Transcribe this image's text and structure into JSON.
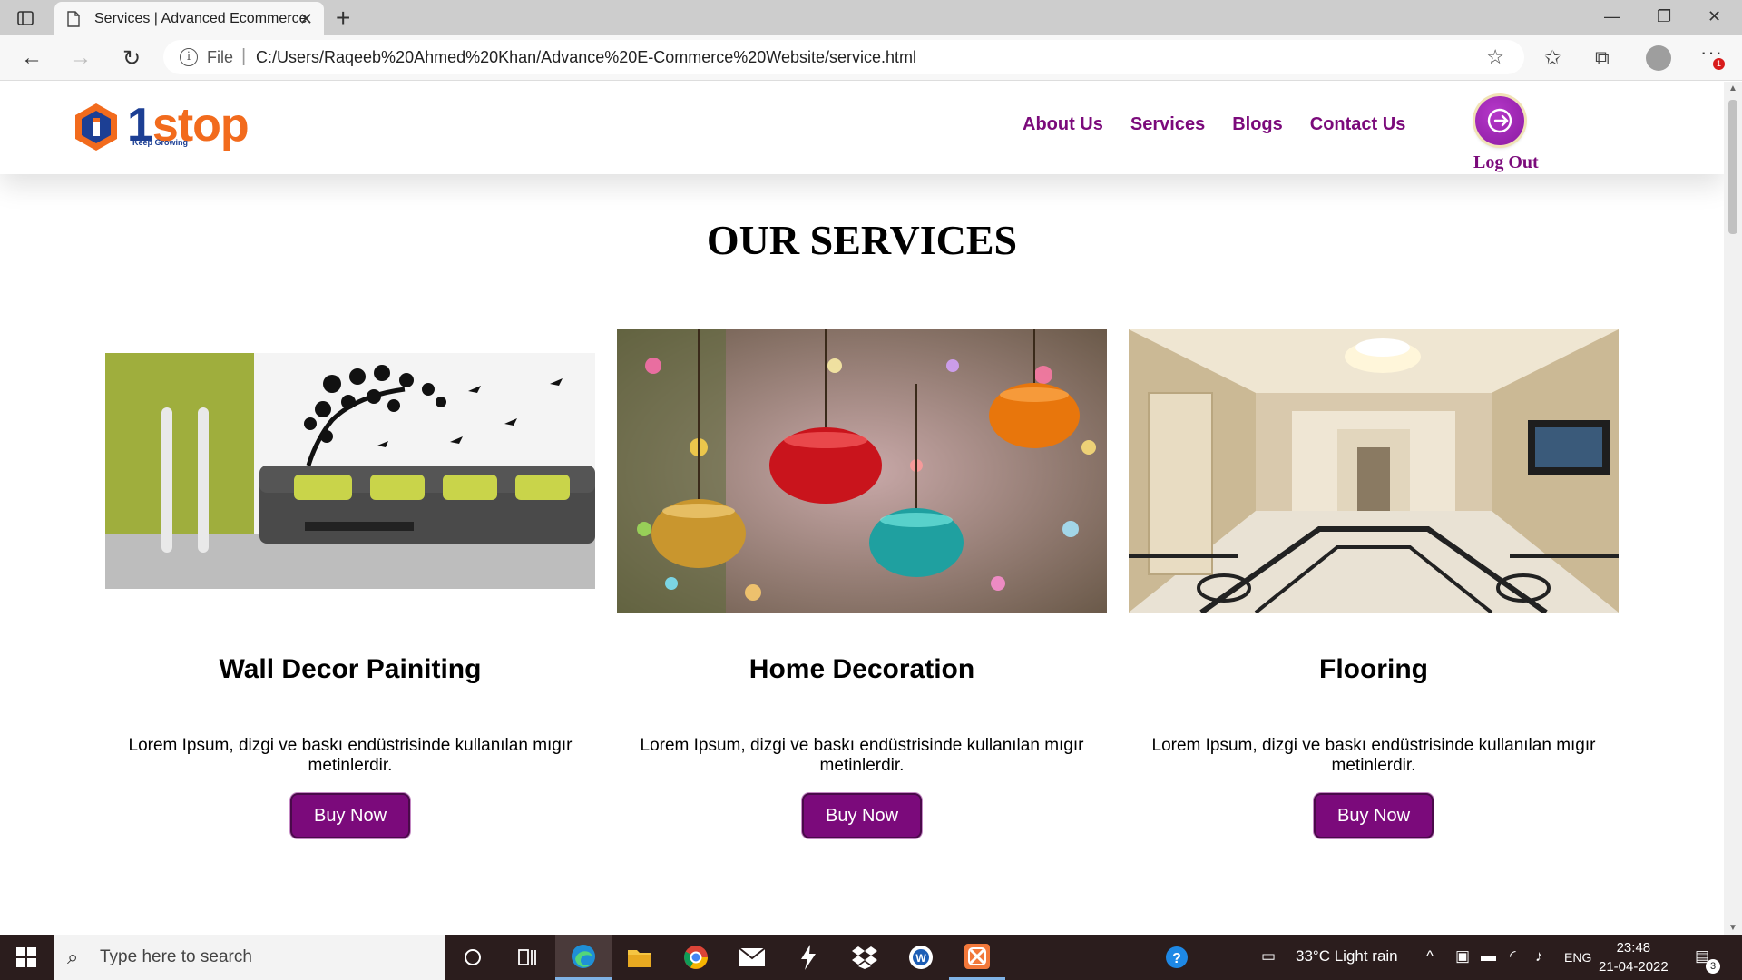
{
  "browser": {
    "tab_title": "Services | Advanced Ecommerce",
    "url_scheme_label": "File",
    "url": "C:/Users/Raqeeb%20Ahmed%20Khan/Advance%20E-Commerce%20Website/service.html",
    "notification_count": "1"
  },
  "site": {
    "logo_text_one": "1",
    "logo_text_stop": "stop",
    "logo_tagline": "Keep Growing",
    "nav": [
      "About Us",
      "Services",
      "Blogs",
      "Contact Us"
    ],
    "logout_label": "Log Out",
    "section_title": "OUR SERVICES",
    "services": [
      {
        "name": "Wall Decor Painiting",
        "description": "Lorem Ipsum, dizgi ve baskı endüstrisinde kullanılan mıgır metinlerdir.",
        "button": "Buy Now"
      },
      {
        "name": "Home Decoration",
        "description": "Lorem Ipsum, dizgi ve baskı endüstrisinde kullanılan mıgır metinlerdir.",
        "button": "Buy Now"
      },
      {
        "name": "Flooring",
        "description": "Lorem Ipsum, dizgi ve baskı endüstrisinde kullanılan mıgır metinlerdir.",
        "button": "Buy Now"
      }
    ],
    "brand_color": "#7b0a7b"
  },
  "taskbar": {
    "search_placeholder": "Type here to search",
    "weather": "33°C  Light rain",
    "language": "ENG",
    "time": "23:48",
    "date": "21-04-2022",
    "notifications": "3"
  }
}
